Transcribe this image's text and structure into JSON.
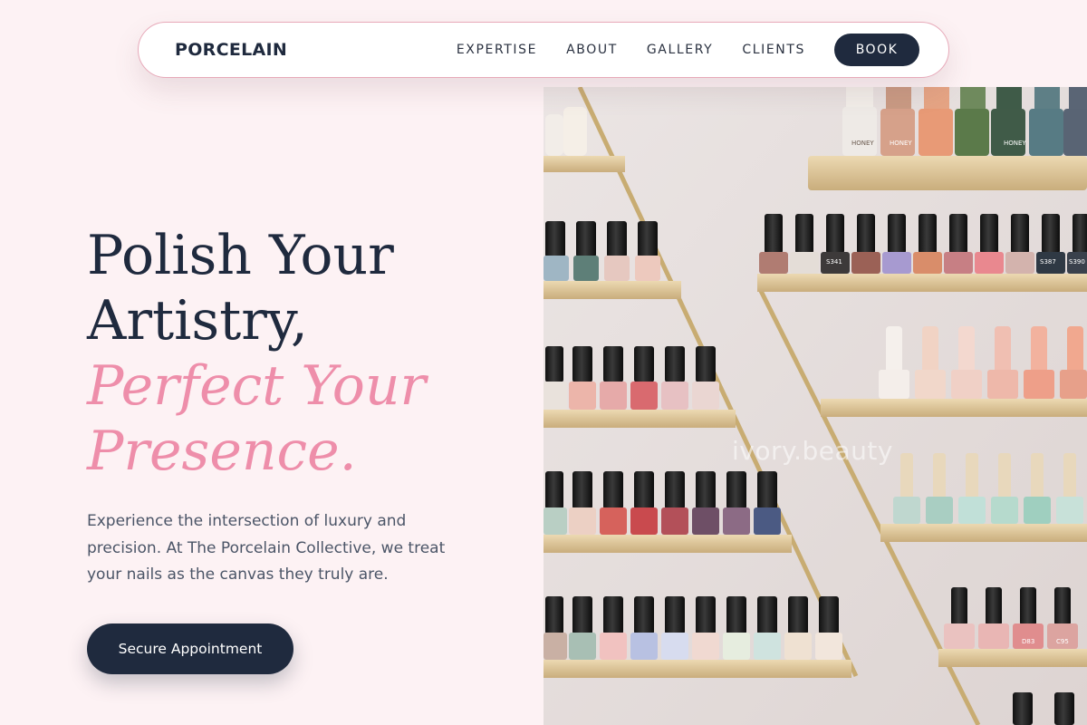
{
  "nav": {
    "logo": "PORCELAIN",
    "links": [
      "EXPERTISE",
      "ABOUT",
      "GALLERY",
      "CLIENTS"
    ],
    "book_label": "BOOK"
  },
  "hero": {
    "headline_line1": "Polish Your",
    "headline_line2": "Artistry,",
    "headline_accent1": "Perfect Your",
    "headline_accent2": "Presence.",
    "description": "Experience the intersection of luxury and precision. At The Porcelain Collective, we treat your nails as the canvas they truly are.",
    "cta_label": "Secure Appointment"
  },
  "image": {
    "watermark": "ivory.beauty",
    "bottle_codes": [
      "S341",
      "S387",
      "S390",
      "D83",
      "C95"
    ],
    "bottle_brand": "HONEY"
  },
  "colors": {
    "background": "#fdf2f4",
    "navy": "#1f2a3e",
    "accent_pink": "#ee8eaa",
    "nav_border": "#e7a9b9"
  }
}
